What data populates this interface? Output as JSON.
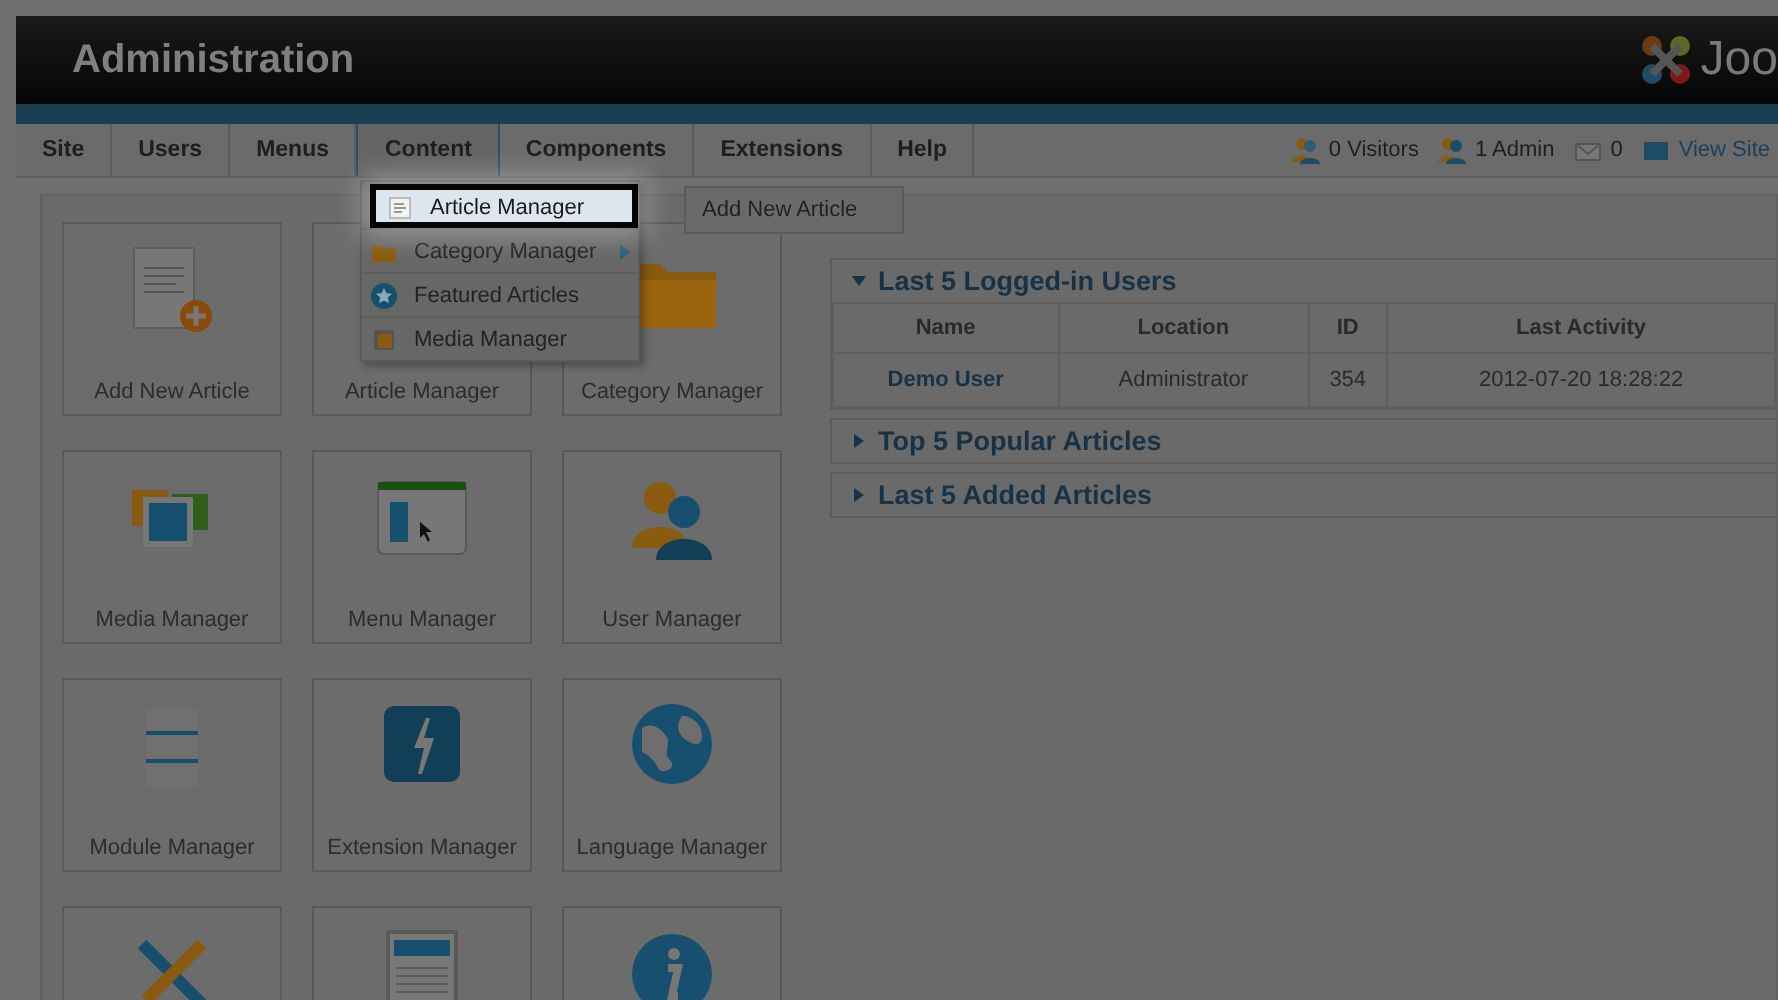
{
  "header": {
    "title": "Administration",
    "logo_text": "Joo"
  },
  "menu": [
    {
      "label": "Site",
      "selected": false
    },
    {
      "label": "Users",
      "selected": false
    },
    {
      "label": "Menus",
      "selected": false
    },
    {
      "label": "Content",
      "selected": true
    },
    {
      "label": "Components",
      "selected": false
    },
    {
      "label": "Extensions",
      "selected": false
    },
    {
      "label": "Help",
      "selected": false
    }
  ],
  "status": [
    {
      "kind": "visitors",
      "text": "0 Visitors"
    },
    {
      "kind": "admin",
      "text": "1 Admin"
    },
    {
      "kind": "messages",
      "text": "0"
    },
    {
      "kind": "site",
      "text": "View Site"
    }
  ],
  "dropdown": {
    "items": [
      {
        "kind": "article",
        "label": "Article Manager",
        "selected": true,
        "has_submenu": false,
        "submenu": [
          "Add New Article"
        ]
      },
      {
        "kind": "category",
        "label": "Category Manager",
        "selected": false,
        "has_submenu": true
      },
      {
        "kind": "featured",
        "label": "Featured Articles",
        "selected": false,
        "has_submenu": false
      },
      {
        "kind": "media",
        "label": "Media Manager",
        "selected": false,
        "has_submenu": false
      }
    ]
  },
  "quickicons": [
    {
      "kind": "add-article",
      "label": "Add New Article"
    },
    {
      "kind": "articles",
      "label": "Article Manager"
    },
    {
      "kind": "folder",
      "label": "Category Manager"
    },
    {
      "kind": "media",
      "label": "Media Manager"
    },
    {
      "kind": "menu",
      "label": "Menu Manager"
    },
    {
      "kind": "users",
      "label": "User Manager"
    },
    {
      "kind": "modules",
      "label": "Module Manager"
    },
    {
      "kind": "extensions",
      "label": "Extension Manager"
    },
    {
      "kind": "language",
      "label": "Language Manager"
    },
    {
      "kind": "tools"
    },
    {
      "kind": "document"
    },
    {
      "kind": "info"
    }
  ],
  "modules": [
    {
      "title": "Last 5 Logged-in Users",
      "expanded": true,
      "table": {
        "columns": [
          "Name",
          "Location",
          "ID",
          "Last Activity"
        ],
        "rows": [
          [
            "Demo User",
            "Administrator",
            "354",
            "2012-07-20 18:28:22"
          ]
        ]
      }
    },
    {
      "title": "Top 5 Popular Articles",
      "expanded": false
    },
    {
      "title": "Last 5 Added Articles",
      "expanded": false
    }
  ]
}
